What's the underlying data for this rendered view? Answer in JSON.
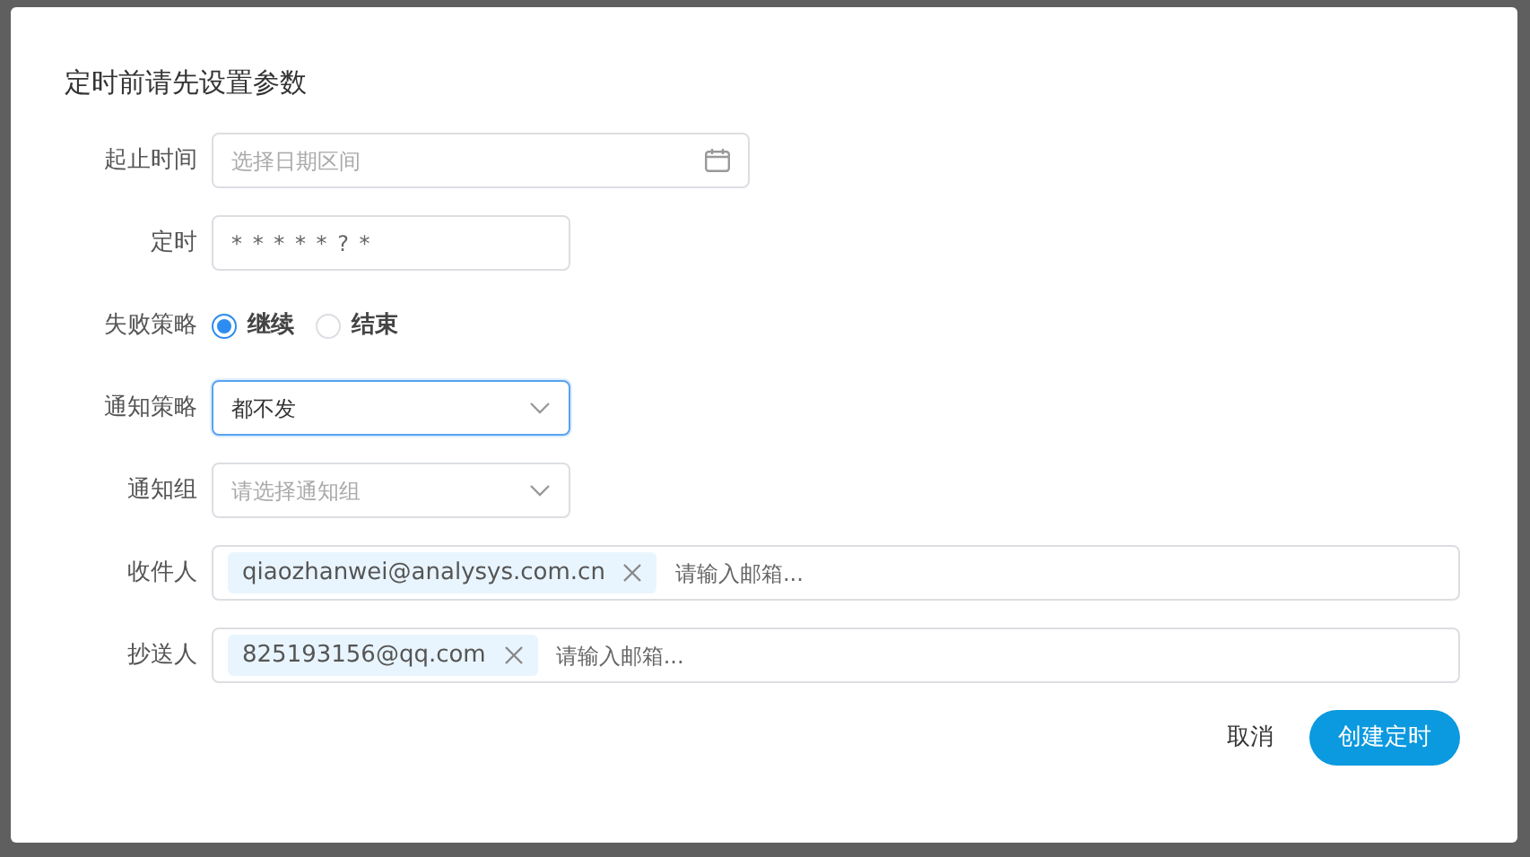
{
  "dialog": {
    "title": "定时前请先设置参数",
    "fields": [
      {
        "kind": "daterange",
        "label": "起止时间",
        "placeholder": "选择日期区间"
      },
      {
        "kind": "text",
        "label": "定时",
        "value": "* * * * * ? *"
      },
      {
        "kind": "radio",
        "label": "失败策略",
        "options": [
          {
            "label": "继续",
            "selected": true
          },
          {
            "label": "结束",
            "selected": false
          }
        ]
      },
      {
        "kind": "select",
        "label": "通知策略",
        "value": "都不发",
        "focused": true
      },
      {
        "kind": "select",
        "label": "通知组",
        "placeholder": "请选择通知组",
        "focused": false
      },
      {
        "kind": "tags",
        "label": "收件人",
        "tags": [
          "qiaozhanwei@analysys.com.cn"
        ],
        "placeholder": "请输入邮箱..."
      },
      {
        "kind": "tags",
        "label": "抄送人",
        "tags": [
          "825193156@qq.com"
        ],
        "placeholder": "请输入邮箱..."
      }
    ],
    "buttons": [
      {
        "kind": "text",
        "label": "取消"
      },
      {
        "kind": "primary",
        "label": "创建定时"
      }
    ]
  }
}
